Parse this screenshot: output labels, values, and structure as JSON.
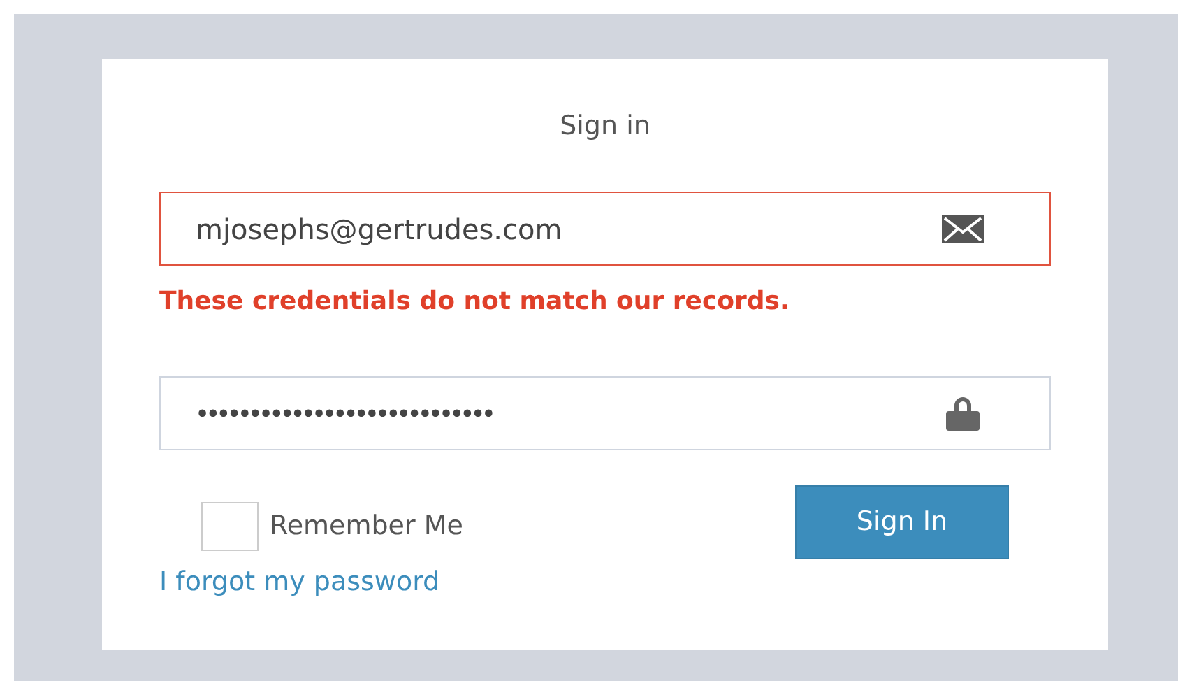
{
  "title": "Sign in",
  "email": {
    "value": "mjosephs@gertrudes.com",
    "error": true
  },
  "error_message": "These credentials do not match our records.",
  "password": {
    "value": "••••••••••••••••••••••••••••",
    "error": false
  },
  "remember": {
    "label": "Remember Me",
    "checked": false
  },
  "submit": "Sign In",
  "forgot_link": "I forgot my password"
}
